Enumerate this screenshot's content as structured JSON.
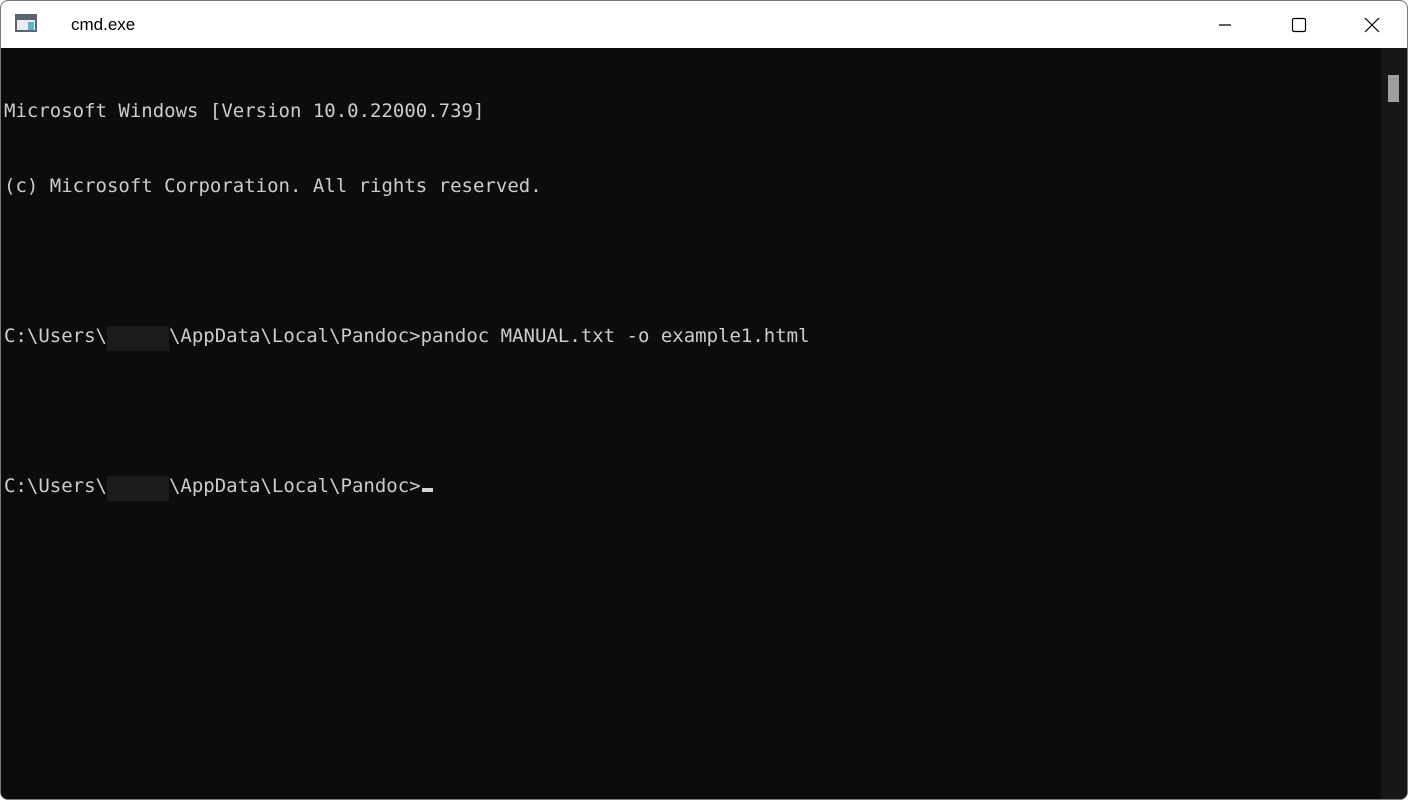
{
  "window": {
    "title": "cmd.exe",
    "app_icon": "console-app-icon",
    "controls": {
      "minimize_icon": "minimize-icon",
      "maximize_icon": "maximize-icon",
      "close_icon": "close-icon"
    }
  },
  "console": {
    "lines": [
      {
        "text": "Microsoft Windows [Version 10.0.22000.739]"
      },
      {
        "text": "(c) Microsoft Corporation. All rights reserved."
      },
      {
        "text": ""
      },
      {
        "prefix": "C:\\Users\\",
        "suffix": "\\AppData\\Local\\Pandoc>pandoc MANUAL.txt -o example1.html"
      },
      {
        "text": ""
      },
      {
        "prefix": "C:\\Users\\",
        "suffix": "\\AppData\\Local\\Pandoc>"
      }
    ]
  },
  "colors": {
    "background": "#0c0c0c",
    "foreground": "#cccccc",
    "titlebar": "#ffffff"
  }
}
